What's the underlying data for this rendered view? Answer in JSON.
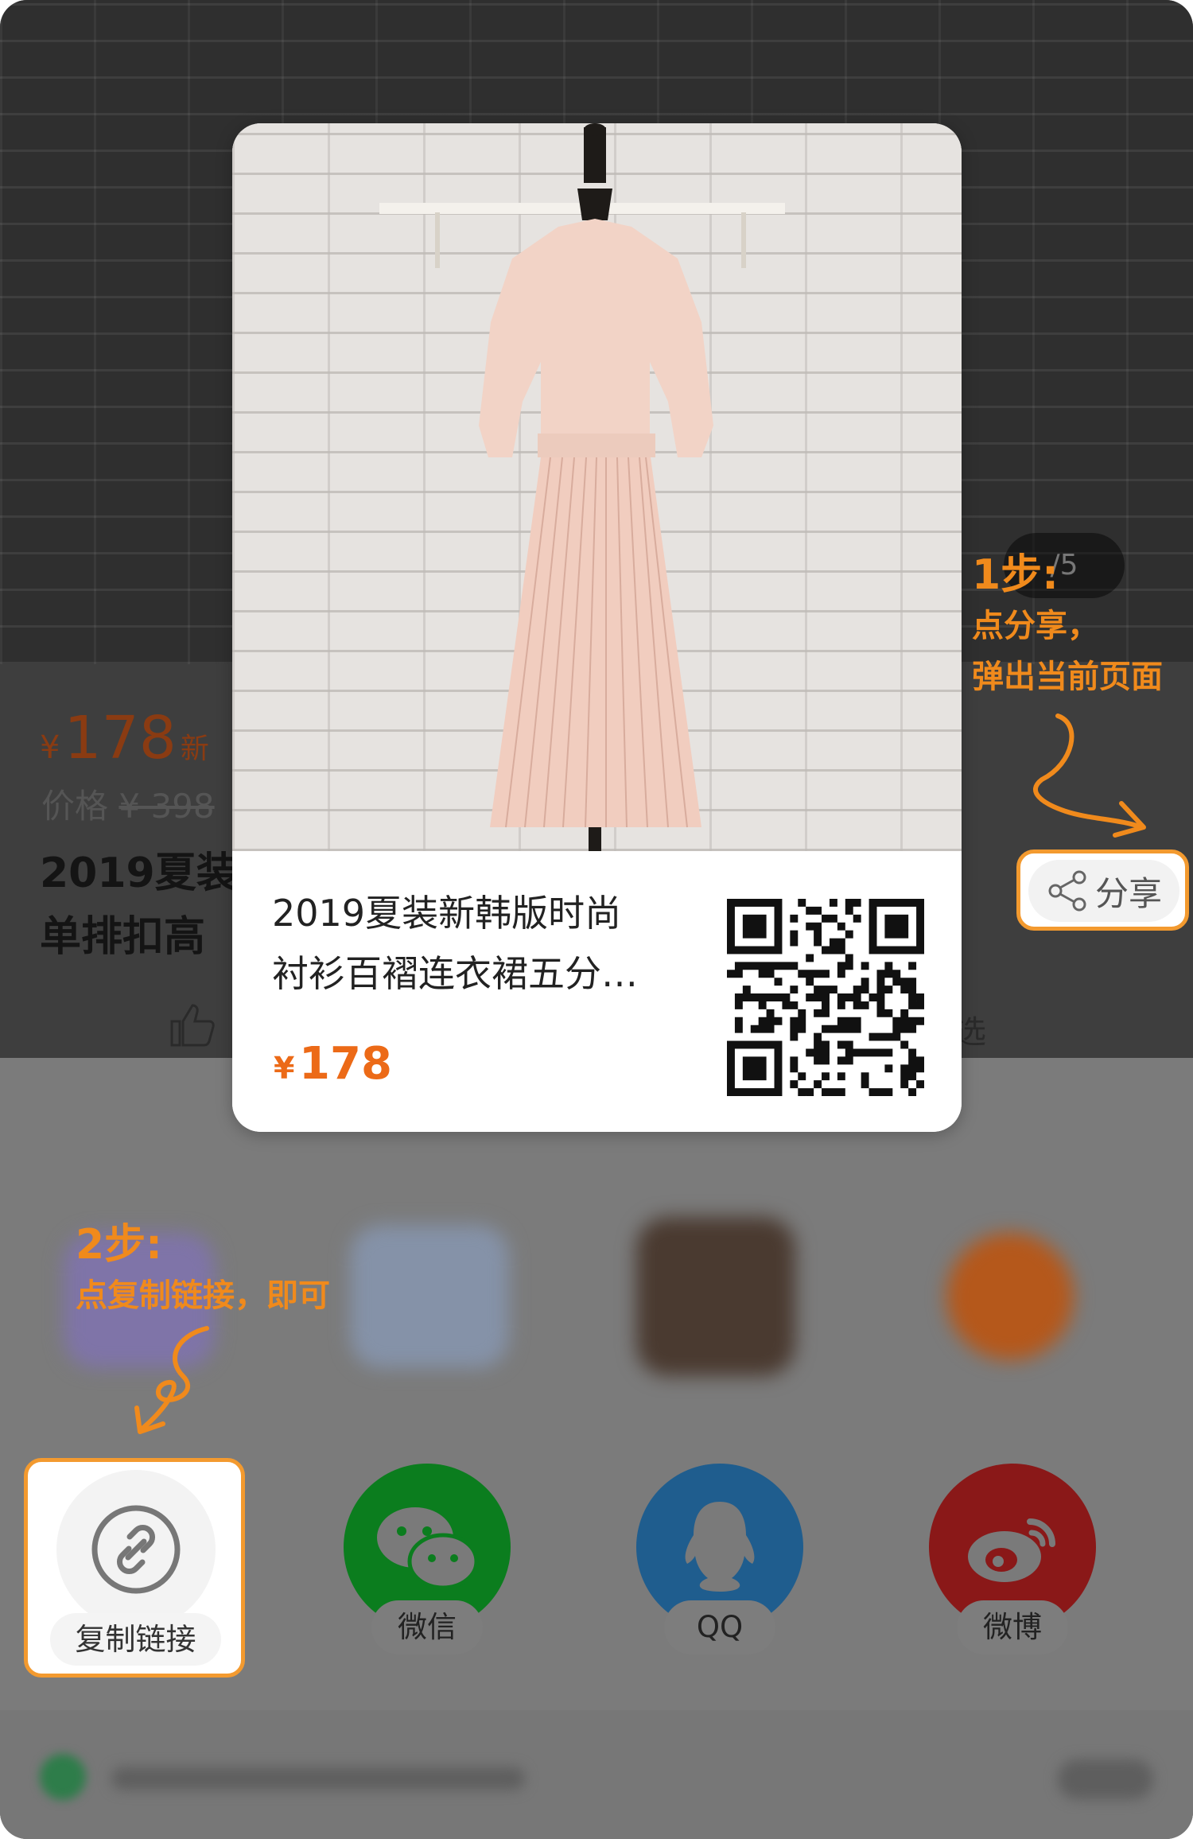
{
  "background_page": {
    "price_symbol": "¥",
    "price": "178",
    "price_suffix": "新",
    "original_price_label": "价格",
    "original_price": "¥ 398",
    "title": "2019夏装\n单排扣高",
    "image_counter": "/5",
    "select_label": "选",
    "share_button_label": "分享"
  },
  "poster": {
    "title": "2019夏装新韩版时尚\n衬衫百褶连衣裙五分…",
    "price_symbol": "¥",
    "price": "178"
  },
  "share_options": [
    {
      "label": "复制链接",
      "icon": "link-icon",
      "color": "#f3f3f3"
    },
    {
      "label": "微信",
      "icon": "wechat-icon",
      "color": "#0b7d1e"
    },
    {
      "label": "QQ",
      "icon": "qq-penguin-icon",
      "color": "#1f5d8e"
    },
    {
      "label": "微博",
      "icon": "weibo-icon",
      "color": "#8a1818"
    }
  ],
  "annotations": {
    "step1": {
      "step": "1步:",
      "line1": "点分享，",
      "line2": "弹出当前页面"
    },
    "step2": {
      "step": "2步:",
      "line1": "点复制链接，即可"
    }
  },
  "colors": {
    "accent_orange": "#f39a2f",
    "price_orange": "#ec6a17"
  }
}
